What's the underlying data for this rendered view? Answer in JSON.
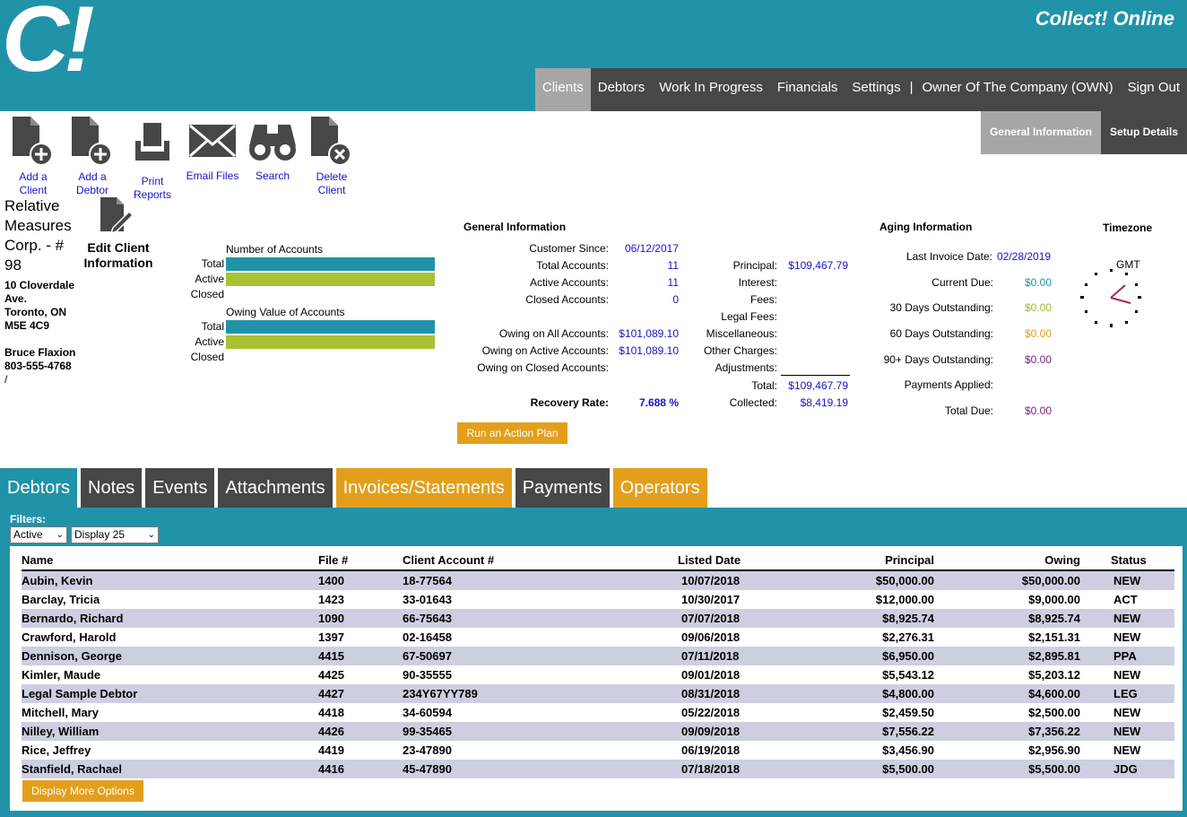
{
  "header": {
    "logo": "C!",
    "app_title": "Collect! Online"
  },
  "main_nav": {
    "clients": "Clients",
    "debtors": "Debtors",
    "wip": "Work In Progress",
    "financials": "Financials",
    "settings": "Settings",
    "separator": "|",
    "owner": "Owner Of The Company (OWN)",
    "sign_out": "Sign Out"
  },
  "sub_tabs": {
    "general": "General Information",
    "setup": "Setup Details"
  },
  "toolbar": {
    "add_client": [
      "Add a",
      "Client"
    ],
    "add_debtor": [
      "Add a",
      "Debtor"
    ],
    "print_reports": [
      "Print",
      "Reports"
    ],
    "email_files": "Email Files",
    "search": "Search",
    "delete_client": [
      "Delete",
      "Client"
    ]
  },
  "client": {
    "name_lines": [
      "Relative",
      "Measures",
      "Corp. - #",
      "98"
    ],
    "address_lines": [
      "10 Cloverdale",
      "Ave.",
      "Toronto, ON",
      "M5E 4C9"
    ],
    "contact": "Bruce Flaxion",
    "phone": "803-555-4768",
    "extra": "/",
    "edit_label": [
      "Edit Client",
      "Information"
    ]
  },
  "accounts_bars": {
    "number_title": "Number of Accounts",
    "value_title": "Owing Value of Accounts",
    "labels": [
      "Total",
      "Active",
      "Closed"
    ],
    "number_fill": {
      "total": 1.0,
      "active": 1.0,
      "closed": 0
    },
    "value_fill": {
      "total": 1.0,
      "active": 1.0,
      "closed": 0
    },
    "colors": {
      "total": "#2193a8",
      "active": "#a8c236"
    }
  },
  "general_info": {
    "title": "General Information",
    "customer_since_label": "Customer Since:",
    "customer_since": "06/12/2017",
    "total_accounts_label": "Total Accounts:",
    "total_accounts": "11",
    "active_accounts_label": "Active Accounts:",
    "active_accounts": "11",
    "closed_accounts_label": "Closed Accounts:",
    "closed_accounts": "0",
    "owing_all_label": "Owing on All Accounts:",
    "owing_all": "$101,089.10",
    "owing_active_label": "Owing on Active Accounts:",
    "owing_active": "$101,089.10",
    "owing_closed_label": "Owing on Closed Accounts:",
    "recovery_rate_label": "Recovery Rate:",
    "recovery_rate": "7.688 %",
    "principal_label": "Principal:",
    "principal": "$109,467.79",
    "interest_label": "Interest:",
    "fees_label": "Fees:",
    "legal_fees_label": "Legal Fees:",
    "misc_label": "Miscellaneous:",
    "other_label": "Other Charges:",
    "adjustments_label": "Adjustments:",
    "total_label": "Total:",
    "total": "$109,467.79",
    "collected_label": "Collected:",
    "collected": "$8,419.19",
    "run_action_plan": "Run an Action Plan"
  },
  "aging": {
    "title": "Aging Information",
    "last_invoice_label": "Last Invoice Date:",
    "last_invoice": "02/28/2019",
    "current_due_label": "Current Due:",
    "current_due": "$0.00",
    "d30_label": "30 Days Outstanding:",
    "d30": "$0.00",
    "d60_label": "60 Days Outstanding:",
    "d60": "$0.00",
    "d90_label": "90+ Days Outstanding:",
    "d90": "$0.00",
    "payments_label": "Payments Applied:",
    "total_due_label": "Total Due:",
    "total_due": "$0.00",
    "colors": {
      "current": "#2193a8",
      "d30": "#9bbb32",
      "d60": "#e39f1c",
      "d90": "#7a1f7a",
      "total": "#7a1f7a"
    }
  },
  "timezone": {
    "title": "Timezone",
    "zone": "GMT"
  },
  "bottom_tabs": [
    "Debtors",
    "Notes",
    "Events",
    "Attachments",
    "Invoices/Statements",
    "Payments",
    "Operators"
  ],
  "filters": {
    "label": "Filters:",
    "status_selected": "Active",
    "display_selected": "Display 25"
  },
  "table": {
    "headers": [
      "Name",
      "File #",
      "Client Account #",
      "Listed Date",
      "Principal",
      "Owing",
      "Status"
    ],
    "rows": [
      [
        "Aubin, Kevin",
        "1400",
        "18-77564",
        "10/07/2018",
        "$50,000.00",
        "$50,000.00",
        "NEW"
      ],
      [
        "Barclay, Tricia",
        "1423",
        "33-01643",
        "10/30/2017",
        "$12,000.00",
        "$9,000.00",
        "ACT"
      ],
      [
        "Bernardo, Richard",
        "1090",
        "66-75643",
        "07/07/2018",
        "$8,925.74",
        "$8,925.74",
        "NEW"
      ],
      [
        "Crawford, Harold",
        "1397",
        "02-16458",
        "09/06/2018",
        "$2,276.31",
        "$2,151.31",
        "NEW"
      ],
      [
        "Dennison, George",
        "4415",
        "67-50697",
        "07/11/2018",
        "$6,950.00",
        "$2,895.81",
        "PPA"
      ],
      [
        "Kimler, Maude",
        "4425",
        "90-35555",
        "09/01/2018",
        "$5,543.12",
        "$5,203.12",
        "NEW"
      ],
      [
        "Legal Sample Debtor",
        "4427",
        "234Y67YY789",
        "08/31/2018",
        "$4,800.00",
        "$4,600.00",
        "LEG"
      ],
      [
        "Mitchell, Mary",
        "4418",
        "34-60594",
        "05/22/2018",
        "$2,459.50",
        "$2,500.00",
        "NEW"
      ],
      [
        "Nilley, William",
        "4426",
        "99-35465",
        "09/09/2018",
        "$7,556.22",
        "$7,356.22",
        "NEW"
      ],
      [
        "Rice, Jeffrey",
        "4419",
        "23-47890",
        "06/19/2018",
        "$3,456.90",
        "$2,956.90",
        "NEW"
      ],
      [
        "Stanfield, Rachael",
        "4416",
        "45-47890",
        "07/18/2018",
        "$5,500.00",
        "$5,500.00",
        "JDG"
      ]
    ],
    "more_options": "Display More Options"
  }
}
